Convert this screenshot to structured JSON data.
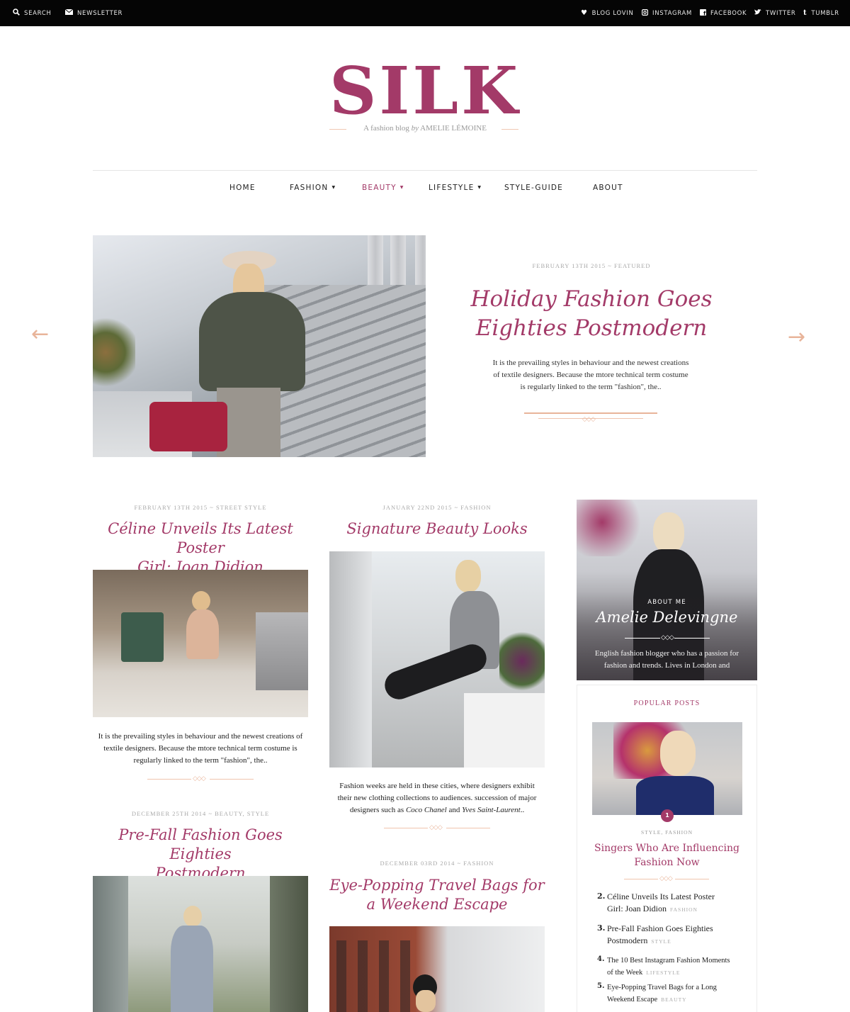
{
  "topbar": {
    "left": [
      {
        "icon": "search-icon",
        "label": "SEARCH"
      },
      {
        "icon": "envelope-icon",
        "label": "NEWSLETTER"
      }
    ],
    "right": [
      {
        "icon": "heart-icon",
        "label": "BLOG LOVIN"
      },
      {
        "icon": "instagram-icon",
        "label": "INSTAGRAM"
      },
      {
        "icon": "facebook-icon",
        "label": "FACEBOOK"
      },
      {
        "icon": "twitter-icon",
        "label": "TWITTER"
      },
      {
        "icon": "tumblr-icon",
        "label": "TUMBLR"
      }
    ]
  },
  "brand": {
    "logo": "SILK",
    "tagline_pre": "A fashion blog ",
    "tagline_by": "by",
    "tagline_name": " AMELIE LÉMOINE",
    "accent_color": "#a33a68"
  },
  "nav": {
    "items": [
      "HOME",
      "FASHION",
      "BEAUTY",
      "LIFESTYLE",
      "STYLE-GUIDE",
      "ABOUT"
    ],
    "active": "BEAUTY"
  },
  "featured": {
    "meta": "FEBRUARY 13TH 2015 ~ FEATURED",
    "title_line1": "Holiday Fashion Goes",
    "title_line2": "Eighties Postmodern",
    "excerpt_line1": "It is the prevailing styles in behaviour and the newest creations",
    "excerpt_line2": "of textile designers. Because the mtore technical term costume",
    "excerpt_line3": "is regularly linked to the term \"fashion\", the..",
    "prev_arrow": "←",
    "next_arrow": "→"
  },
  "posts": {
    "p1": {
      "meta": "FEBRUARY 13TH 2015 ~ STREET STYLE",
      "title_line1": "Céline Unveils Its Latest Poster",
      "title_line2": "Girl: Joan Didion",
      "excerpt_line1": "It is the prevailing styles in behaviour and the newest creations of",
      "excerpt_line2": "textile designers. Because the mtore technical term costume is",
      "excerpt_line3": "regularly linked to the term \"fashion\", the.."
    },
    "p2": {
      "meta": "JANUARY 22ND 2015 ~ FASHION",
      "title_line1": "Signature Beauty Looks",
      "excerpt_line1": "Fashion weeks are held in these cities, where designers exhibit",
      "excerpt_line2": "their new clothing collections to audiences.  succession of major",
      "excerpt_line3_pre": "designers such as ",
      "excerpt_line3_name1": "Coco Chanel",
      "excerpt_line3_mid": " and ",
      "excerpt_line3_name2": "Yves Saint-Laurent",
      "excerpt_line3_post": ".."
    },
    "p3": {
      "meta": "DECEMBER 25TH 2014 ~ BEAUTY, STYLE",
      "title_line1": "Pre-Fall Fashion Goes Eighties",
      "title_line2": "Postmodern"
    },
    "p4": {
      "meta": "DECEMBER 03RD 2014 ~ FASHION",
      "title_line1": "Eye-Popping Travel Bags for",
      "title_line2": "a Weekend Escape"
    }
  },
  "sidebar": {
    "about": {
      "kicker": "ABOUT ME",
      "name": "Amelie Delevingne",
      "bio_line1": "English fashion blogger who has a passion for",
      "bio_line2": "fashion and trends. Lives in London and"
    },
    "popular": {
      "heading": "POPULAR POSTS",
      "featured_rank": "1",
      "featured_cats": "STYLE, FASHION",
      "featured_title_line1": "Singers Who Are Influencing",
      "featured_title_line2": "Fashion Now",
      "items": [
        {
          "num": "2.",
          "line1": "Céline Unveils Its Latest Poster",
          "line2": "Girl: Joan Didion",
          "cat": "FASHION"
        },
        {
          "num": "3.",
          "line1": "Pre-Fall Fashion Goes Eighties",
          "line2": "Postmodern",
          "cat": "STYLE"
        },
        {
          "num": "4.",
          "line1": "The 10 Best Instagram Fashion Moments",
          "line2": "of the Week",
          "cat": "LIFESTYLE"
        },
        {
          "num": "5.",
          "line1": "Eye-Popping Travel Bags for a Long",
          "line2": "Weekend Escape",
          "cat": "BEAUTY"
        }
      ]
    }
  }
}
